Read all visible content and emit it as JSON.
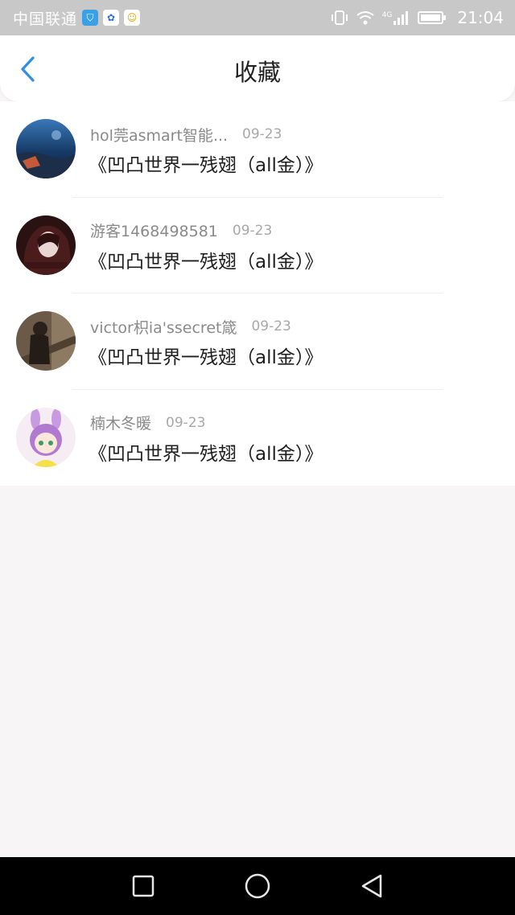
{
  "status_bar": {
    "carrier": "中国联通",
    "network": "4G",
    "time": "21:04"
  },
  "header": {
    "title": "收藏"
  },
  "items": [
    {
      "user": "hol莞asmart智能...",
      "date": "09-23",
      "title": "《凹凸世界一残翅（all金）》"
    },
    {
      "user": "游客1468498581",
      "date": "09-23",
      "title": "《凹凸世界一残翅（all金）》"
    },
    {
      "user": "victor枳ia'ssecret箴",
      "date": "09-23",
      "title": "《凹凸世界一残翅（all金）》"
    },
    {
      "user": "楠木冬暖",
      "date": "09-23",
      "title": "《凹凸世界一残翅（all金）》"
    }
  ],
  "colors": {
    "accent": "#2f8fe8",
    "background": "#f7f5f6"
  }
}
